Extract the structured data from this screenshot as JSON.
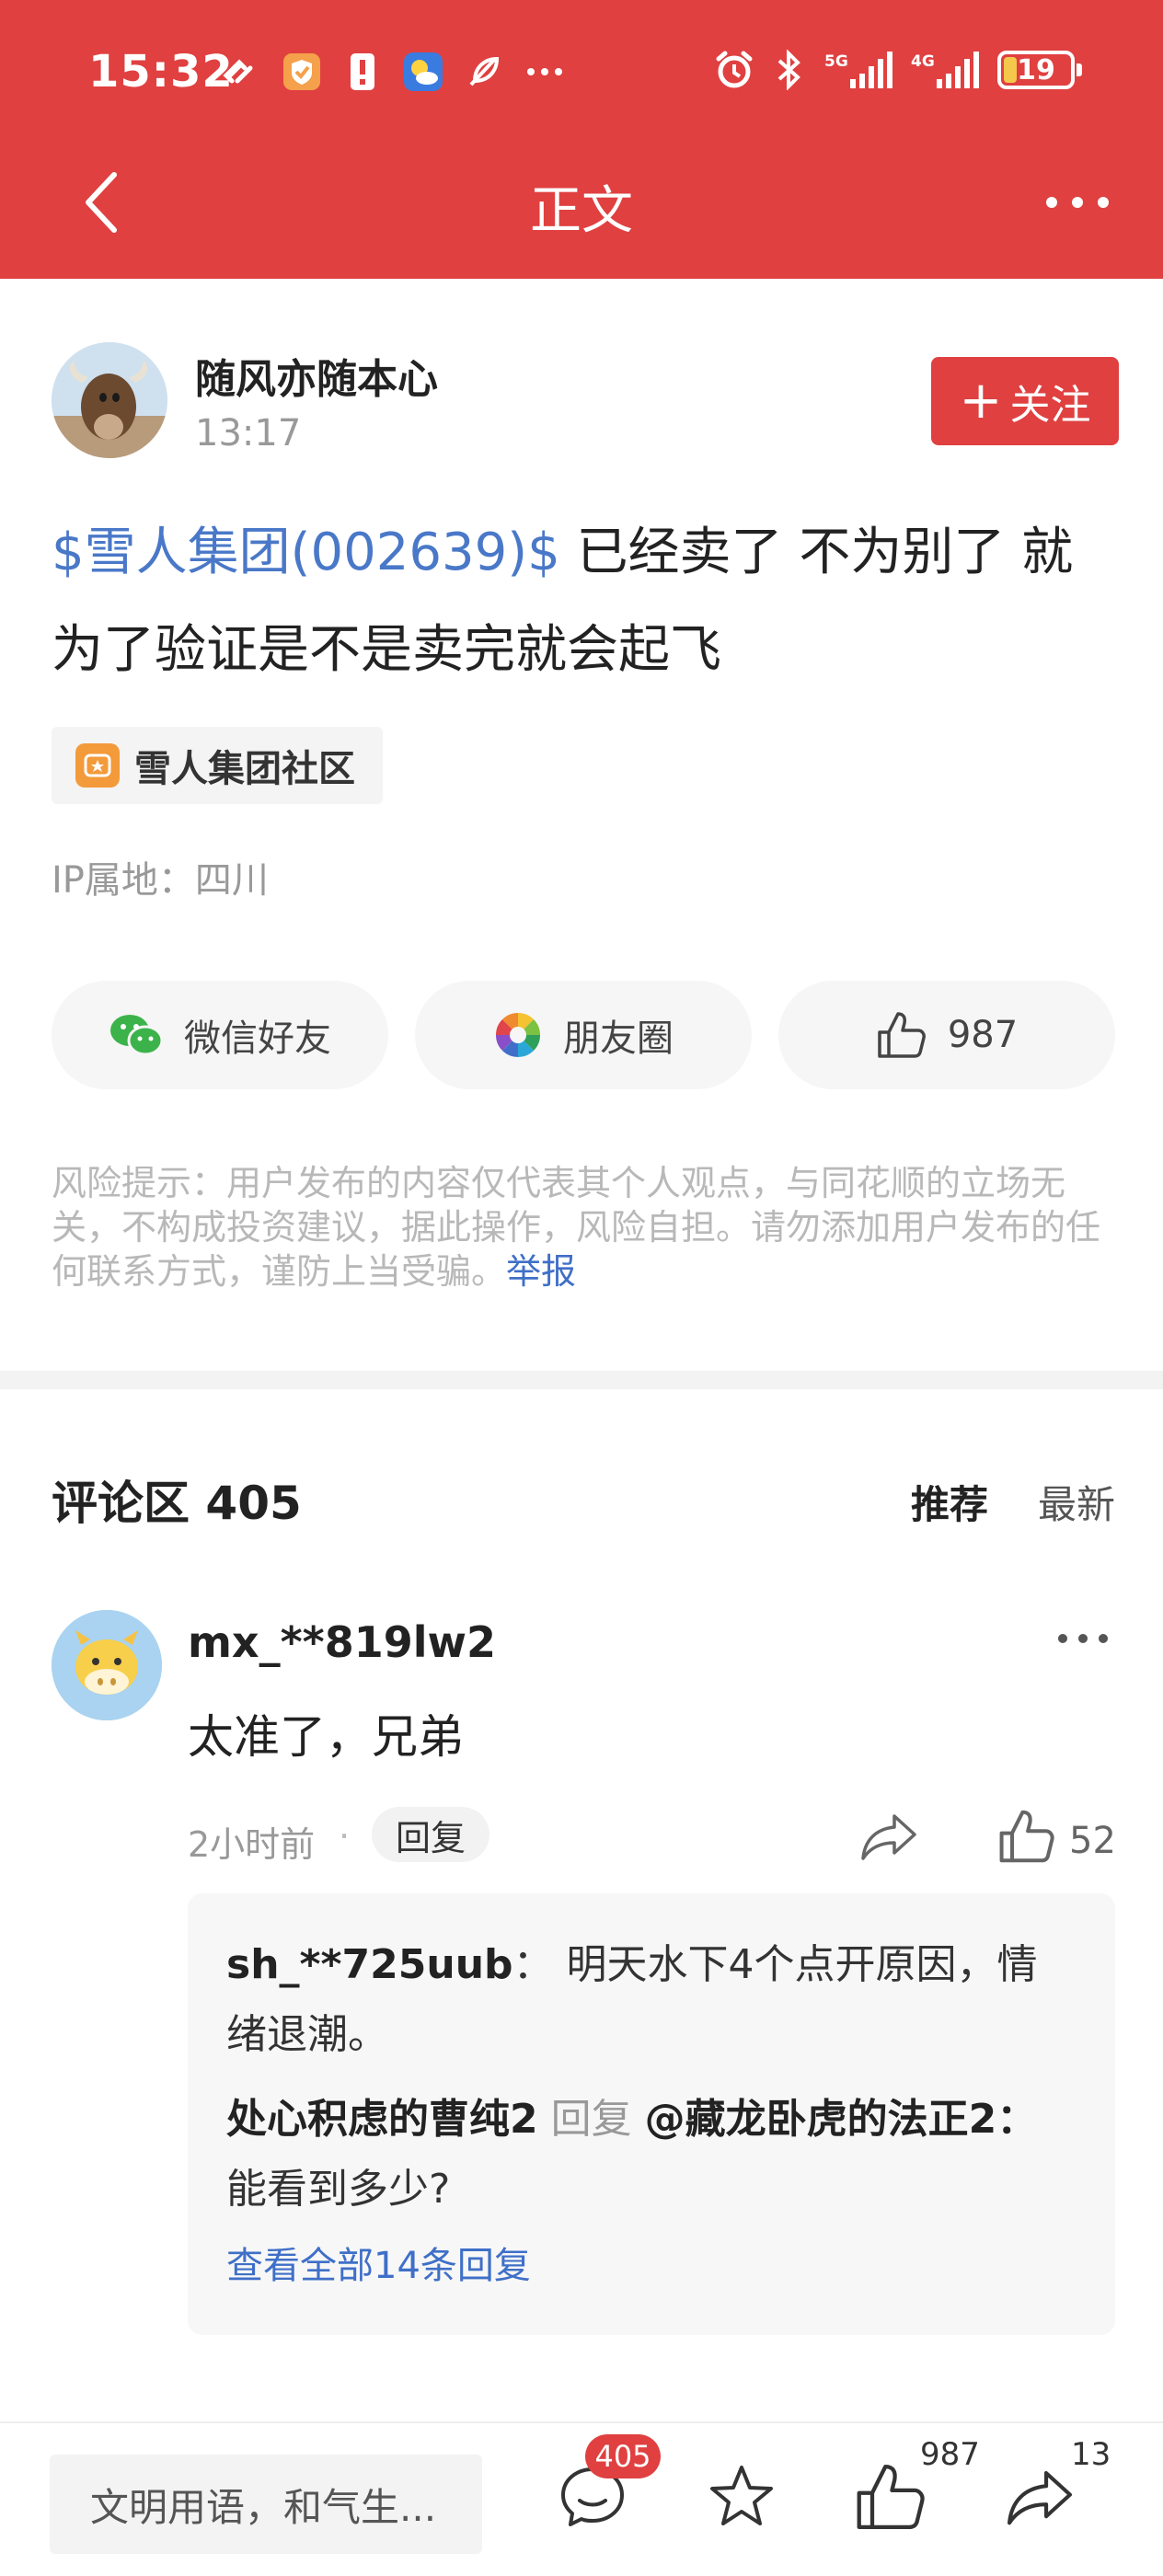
{
  "status_bar": {
    "time": "15:32",
    "network_1": "5G",
    "network_2": "4G",
    "battery": "19"
  },
  "navbar": {
    "title": "正文"
  },
  "post": {
    "author": "随风亦随本心",
    "time": "13:17",
    "follow_label": "关注",
    "stock_tag": "$雪人集团(002639)$",
    "text": " 已经卖了 不为别了 就为了验证是不是卖完就会起飞",
    "community": "雪人集团社区",
    "ip_location": "IP属地：四川"
  },
  "share": {
    "wechat_label": "微信好友",
    "moments_label": "朋友圈",
    "like_count": "987"
  },
  "risk": {
    "text": "风险提示：用户发布的内容仅代表其个人观点，与同花顺的立场无关，不构成投资建议，据此操作，风险自担。请勿添加用户发布的任何联系方式，谨防上当受骗。",
    "report_label": "举报"
  },
  "comments": {
    "title": "评论区 405",
    "sort_recommended": "推荐",
    "sort_latest": "最新",
    "items": [
      {
        "user": "mx_**819lw2",
        "text": "太准了，兄弟",
        "time": "2小时前",
        "dot": "·",
        "reply_label": "回复",
        "likes": "52",
        "replies": [
          {
            "user": "sh_**725uub",
            "sep": "：",
            "text": "明天水下4个点开原因，情绪退潮。"
          },
          {
            "user": "处心积虑的曹纯2",
            "reply_word": "回复",
            "target": "@藏龙卧虎的法正2",
            "sep": "：",
            "text": "能看到多少?"
          }
        ],
        "view_all": "查看全部14条回复"
      }
    ]
  },
  "bottom_bar": {
    "input_placeholder": "文明用语，和气生...",
    "comment_badge": "405",
    "like_count": "987",
    "share_count": "13"
  },
  "colors": {
    "brand_red": "#e04040",
    "link_blue": "#3f6fc8",
    "stock_blue": "#4a78c8"
  }
}
